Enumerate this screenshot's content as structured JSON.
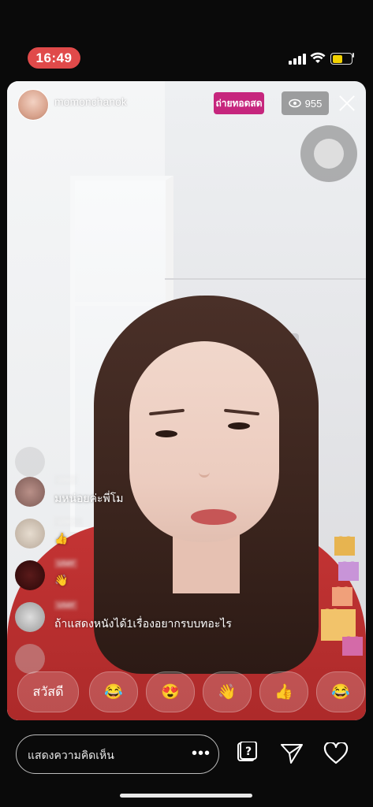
{
  "status_bar": {
    "time": "16:49"
  },
  "header": {
    "host_name": "momonchanok",
    "live_label": "ถ่ายทอดสด",
    "viewer_count": "955"
  },
  "comments": [
    {
      "username": "",
      "text": ""
    },
    {
      "username": "user",
      "text": "มหน่อยค่ะพี่โม"
    },
    {
      "username": "user_",
      "text": "👍"
    },
    {
      "username": "user",
      "text": "👋"
    },
    {
      "username": "user",
      "text": "ถ้าแสดงหนังได้1เรื่องอยากรบบทอะไร"
    }
  ],
  "quick_replies": [
    "สวัสดี",
    "😂",
    "😍",
    "👋",
    "👍",
    "😂"
  ],
  "bottom_bar": {
    "comment_placeholder": "แสดงความคิดเห็น",
    "more": "•••"
  },
  "colors": {
    "live_badge": "#c6267d",
    "time_pill": "#e04a4a",
    "shirt": "#c43434"
  },
  "icons": [
    "signal-icon",
    "wifi-icon",
    "battery-icon",
    "eye-icon",
    "close-icon",
    "camera-flip-icon",
    "question-icon",
    "send-icon",
    "heart-icon"
  ]
}
